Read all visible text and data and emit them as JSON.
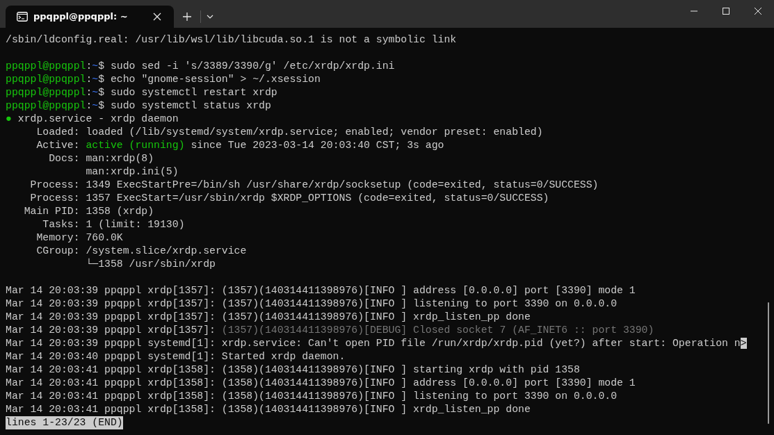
{
  "window": {
    "tab": {
      "title": "ppqppl@ppqppl: ~",
      "selected": true
    }
  },
  "terminal": {
    "lines": [
      {
        "segments": [
          {
            "kind": "text",
            "text": "/sbin/ldconfig.real: /usr/lib/wsl/lib/libcuda.so.1 is not a symbolic link"
          }
        ]
      },
      {
        "kind": "blank"
      },
      {
        "segments": [
          {
            "kind": "user",
            "text": "ppqppl@ppqppl"
          },
          {
            "kind": "text",
            "text": ":"
          },
          {
            "kind": "path",
            "text": "~"
          },
          {
            "kind": "text",
            "text": "$ sudo sed -i 's/3389/3390/g' /etc/xrdp/xrdp.ini"
          }
        ]
      },
      {
        "segments": [
          {
            "kind": "user",
            "text": "ppqppl@ppqppl"
          },
          {
            "kind": "text",
            "text": ":"
          },
          {
            "kind": "path",
            "text": "~"
          },
          {
            "kind": "text",
            "text": "$ echo \"gnome-session\" > ~/.xsession"
          }
        ]
      },
      {
        "segments": [
          {
            "kind": "user",
            "text": "ppqppl@ppqppl"
          },
          {
            "kind": "text",
            "text": ":"
          },
          {
            "kind": "path",
            "text": "~"
          },
          {
            "kind": "text",
            "text": "$ sudo systemctl restart xrdp"
          }
        ]
      },
      {
        "segments": [
          {
            "kind": "user",
            "text": "ppqppl@ppqppl"
          },
          {
            "kind": "text",
            "text": ":"
          },
          {
            "kind": "path",
            "text": "~"
          },
          {
            "kind": "text",
            "text": "$ sudo systemctl status xrdp"
          }
        ]
      },
      {
        "segments": [
          {
            "kind": "active",
            "text": "●"
          },
          {
            "kind": "text",
            "text": " xrdp.service - xrdp daemon"
          }
        ]
      },
      {
        "segments": [
          {
            "kind": "text",
            "text": "     Loaded: loaded (/lib/systemd/system/xrdp.service; enabled; vendor preset: enabled)"
          }
        ]
      },
      {
        "segments": [
          {
            "kind": "text",
            "text": "     Active: "
          },
          {
            "kind": "active",
            "text": "active (running)"
          },
          {
            "kind": "text",
            "text": " since Tue 2023-03-14 20:03:40 CST; 3s ago"
          }
        ]
      },
      {
        "segments": [
          {
            "kind": "text",
            "text": "       Docs: man:xrdp(8)"
          }
        ]
      },
      {
        "segments": [
          {
            "kind": "text",
            "text": "             man:xrdp.ini(5)"
          }
        ]
      },
      {
        "segments": [
          {
            "kind": "text",
            "text": "    Process: 1349 ExecStartPre=/bin/sh /usr/share/xrdp/socksetup (code=exited, status=0/SUCCESS)"
          }
        ]
      },
      {
        "segments": [
          {
            "kind": "text",
            "text": "    Process: 1357 ExecStart=/usr/sbin/xrdp $XRDP_OPTIONS (code=exited, status=0/SUCCESS)"
          }
        ]
      },
      {
        "segments": [
          {
            "kind": "text",
            "text": "   Main PID: 1358 (xrdp)"
          }
        ]
      },
      {
        "segments": [
          {
            "kind": "text",
            "text": "      Tasks: 1 (limit: 19130)"
          }
        ]
      },
      {
        "segments": [
          {
            "kind": "text",
            "text": "     Memory: 760.0K"
          }
        ]
      },
      {
        "segments": [
          {
            "kind": "text",
            "text": "     CGroup: /system.slice/xrdp.service"
          }
        ]
      },
      {
        "segments": [
          {
            "kind": "text",
            "text": "             └─1358 /usr/sbin/xrdp"
          }
        ]
      },
      {
        "kind": "blank"
      },
      {
        "segments": [
          {
            "kind": "text",
            "text": "Mar 14 20:03:39 ppqppl xrdp[1357]: (1357)(140314411398976)[INFO ] address [0.0.0.0] port [3390] mode 1"
          }
        ]
      },
      {
        "segments": [
          {
            "kind": "text",
            "text": "Mar 14 20:03:39 ppqppl xrdp[1357]: (1357)(140314411398976)[INFO ] listening to port 3390 on 0.0.0.0"
          }
        ]
      },
      {
        "segments": [
          {
            "kind": "text",
            "text": "Mar 14 20:03:39 ppqppl xrdp[1357]: (1357)(140314411398976)[INFO ] xrdp_listen_pp done"
          }
        ]
      },
      {
        "segments": [
          {
            "kind": "text",
            "text": "Mar 14 20:03:39 ppqppl xrdp[1357]: "
          },
          {
            "kind": "dim",
            "text": "(1357)(140314411398976)[DEBUG] Closed socket 7 (AF_INET6 :: port 3390)"
          }
        ]
      },
      {
        "segments": [
          {
            "kind": "text",
            "text": "Mar 14 20:03:39 ppqppl systemd[1]: xrdp.service: Can't open PID file /run/xrdp/xrdp.pid (yet?) after start: Operation n"
          },
          {
            "kind": "cursor",
            "text": ">"
          }
        ]
      },
      {
        "segments": [
          {
            "kind": "text",
            "text": "Mar 14 20:03:40 ppqppl systemd[1]: Started xrdp daemon."
          }
        ]
      },
      {
        "segments": [
          {
            "kind": "text",
            "text": "Mar 14 20:03:41 ppqppl xrdp[1358]: (1358)(140314411398976)[INFO ] starting xrdp with pid 1358"
          }
        ]
      },
      {
        "segments": [
          {
            "kind": "text",
            "text": "Mar 14 20:03:41 ppqppl xrdp[1358]: (1358)(140314411398976)[INFO ] address [0.0.0.0] port [3390] mode 1"
          }
        ]
      },
      {
        "segments": [
          {
            "kind": "text",
            "text": "Mar 14 20:03:41 ppqppl xrdp[1358]: (1358)(140314411398976)[INFO ] listening to port 3390 on 0.0.0.0"
          }
        ]
      },
      {
        "segments": [
          {
            "kind": "text",
            "text": "Mar 14 20:03:41 ppqppl xrdp[1358]: (1358)(140314411398976)[INFO ] xrdp_listen_pp done"
          }
        ]
      },
      {
        "kind": "status",
        "segments": [
          {
            "kind": "text",
            "text": "lines 1-23/23 (END)"
          }
        ]
      }
    ]
  }
}
